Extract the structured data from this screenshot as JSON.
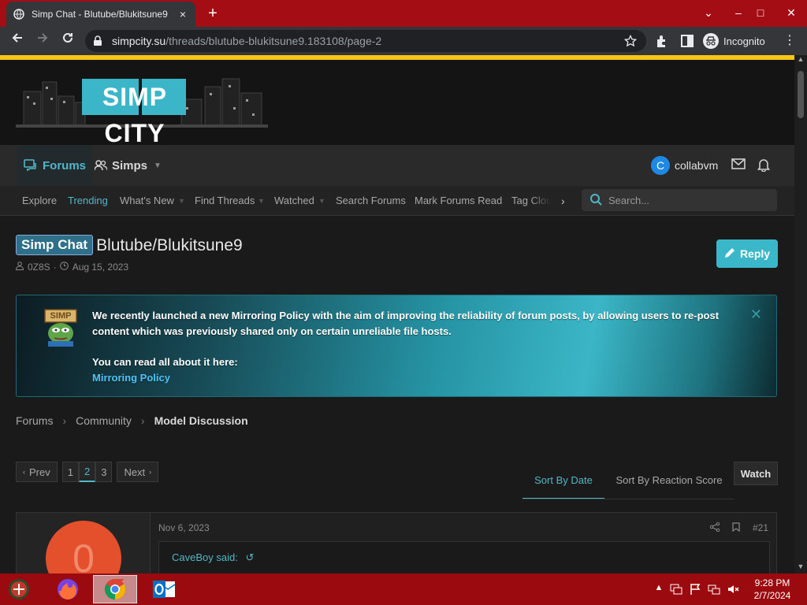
{
  "browser": {
    "tab_title": "Simp Chat - Blutube/Blukitsune9",
    "tab_close": "×",
    "new_tab": "+",
    "url_host": "simpcity.su",
    "url_path": "/threads/blutube-blukitsune9.183108/page-2",
    "incognito_label": "Incognito",
    "window_controls": [
      "⌄",
      "–",
      "□",
      "✕"
    ]
  },
  "site": {
    "logo_text": "SIMP CITY",
    "nav_tabs": [
      {
        "label": "Forums",
        "icon": "forums-icon",
        "active": true
      },
      {
        "label": "Simps",
        "icon": "users-icon",
        "active": false
      }
    ],
    "user": {
      "initial": "C",
      "name": "collabvm"
    },
    "subnav": [
      "Explore",
      "Trending",
      "What's New",
      "Find Threads",
      "Watched",
      "Search Forums",
      "Mark Forums Read",
      "Tag Clou"
    ],
    "search_placeholder": "Search..."
  },
  "thread": {
    "prefix": "Simp Chat",
    "title": "Blutube/Blukitsune9",
    "author": "0Z8S",
    "date": "Aug 15, 2023",
    "reply_label": "Reply"
  },
  "notice": {
    "line1": "We recently launched a new Mirroring Policy with the aim of improving the reliability of forum posts, by allowing users to re-post content which was previously shared only on certain unreliable file hosts.",
    "line2": "You can read all about it here:",
    "link": "Mirroring Policy",
    "badge": "SIMP",
    "close": "✕"
  },
  "breadcrumb": [
    "Forums",
    "Community",
    "Model Discussion"
  ],
  "pagination": {
    "prev": "Prev",
    "next": "Next",
    "pages": [
      "1",
      "2",
      "3"
    ],
    "current": "2"
  },
  "sort": {
    "by_date": "Sort By Date",
    "by_reaction": "Sort By Reaction Score",
    "watch": "Watch"
  },
  "post": {
    "avatar_initial": "0",
    "date": "Nov 6, 2023",
    "number": "#21",
    "quote_author": "CaveBoy said:"
  },
  "taskbar": {
    "time": "9:28 PM",
    "date": "2/7/2024"
  },
  "colors": {
    "accent": "#4fb8c8",
    "gold": "#f5c518",
    "taskbar": "#9b0a0e"
  }
}
